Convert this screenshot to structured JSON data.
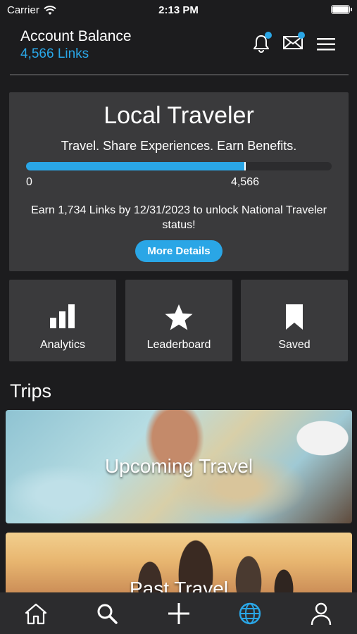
{
  "status_bar": {
    "carrier": "Carrier",
    "time": "2:13 PM"
  },
  "header": {
    "title": "Account Balance",
    "links": "4,566 Links",
    "accent": "#2aa6e6"
  },
  "status_card": {
    "title": "Local Traveler",
    "subtitle": "Travel. Share Experiences. Earn Benefits.",
    "progress_fraction": 0.72,
    "progress_min": "0",
    "progress_max": "4,566",
    "message": "Earn 1,734 Links by 12/31/2023 to unlock National Traveler status!",
    "button": "More Details"
  },
  "tiles": [
    {
      "label": "Analytics",
      "icon": "bar-chart-icon"
    },
    {
      "label": "Leaderboard",
      "icon": "star-icon"
    },
    {
      "label": "Saved",
      "icon": "bookmark-icon"
    }
  ],
  "trips": {
    "heading": "Trips",
    "banners": [
      {
        "label": "Upcoming Travel"
      },
      {
        "label": "Past Travel"
      }
    ]
  },
  "tabbar": {
    "items": [
      {
        "icon": "home-icon"
      },
      {
        "icon": "search-icon"
      },
      {
        "icon": "plus-icon"
      },
      {
        "icon": "globe-icon",
        "active": true
      },
      {
        "icon": "profile-icon"
      }
    ]
  }
}
